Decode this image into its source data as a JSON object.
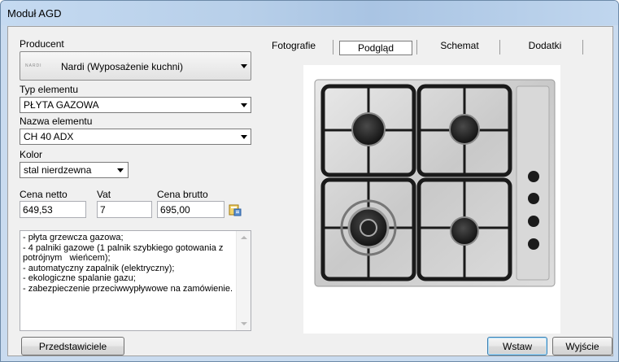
{
  "window": {
    "title": "Moduł AGD"
  },
  "form": {
    "producent_label": "Producent",
    "producent_value": "Nardi (Wyposażenie kuchni)",
    "producent_logo_text": "NARDI",
    "typ_label": "Typ elementu",
    "typ_value": "PŁYTA GAZOWA",
    "nazwa_label": "Nazwa elementu",
    "nazwa_value": "CH 40 ADX",
    "kolor_label": "Kolor",
    "kolor_value": "stal nierdzewna",
    "cena_netto_label": "Cena netto",
    "cena_netto_value": "649,53",
    "vat_label": "Vat",
    "vat_value": "7",
    "cena_brutto_label": "Cena brutto",
    "cena_brutto_value": "695,00",
    "description": "- płyta grzewcza gazowa;\n- 4 palniki gazowe (1 palnik szybkiego gotowania z potrójnym   wieńcem);\n- automatyczny zapalnik (elektryczny);\n- ekologiczne spalanie gazu;\n- zabezpieczenie przeciwwypływowe na zamówienie."
  },
  "tabs": [
    {
      "label": "Fotografie"
    },
    {
      "label": "Podgląd"
    },
    {
      "label": "Schemat"
    },
    {
      "label": "Dodatki"
    }
  ],
  "buttons": {
    "przedstawiciele": "Przedstawiciele",
    "wstaw": "Wstaw",
    "wyjscie": "Wyjście"
  },
  "icons": {
    "calculator": "calculator-icon",
    "close": "close-icon"
  }
}
